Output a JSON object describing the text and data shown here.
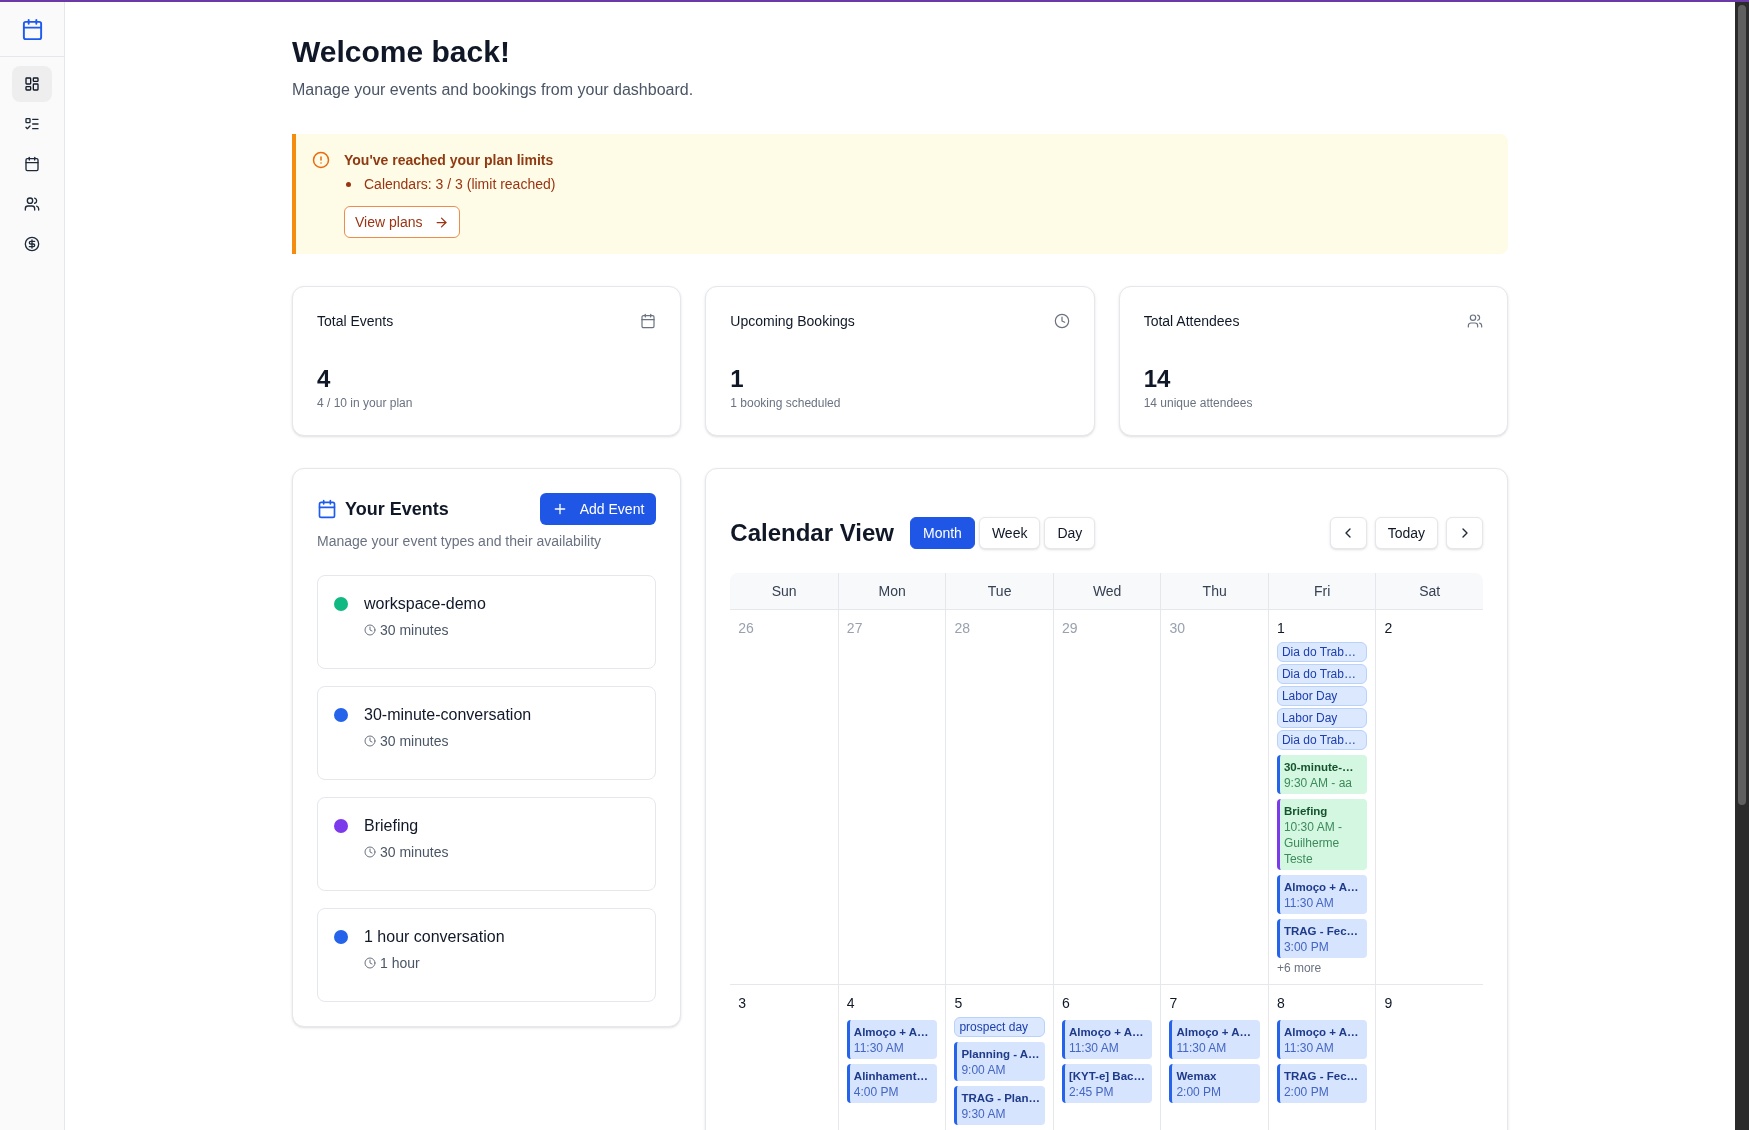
{
  "sidebar": {
    "nav_items": [
      {
        "selected": true
      },
      {
        "selected": false
      },
      {
        "selected": false
      },
      {
        "selected": false
      },
      {
        "selected": false
      }
    ]
  },
  "header": {
    "title": "Welcome back!",
    "subtitle": "Manage your events and bookings from your dashboard."
  },
  "alert": {
    "title": "You've reached your plan limits",
    "items": [
      "Calendars: 3 / 3 (limit reached)"
    ],
    "button": "View plans"
  },
  "stats": [
    {
      "title": "Total Events",
      "value": "4",
      "note": "4 / 10 in your plan"
    },
    {
      "title": "Upcoming Bookings",
      "value": "1",
      "note": "1 booking scheduled"
    },
    {
      "title": "Total Attendees",
      "value": "14",
      "note": "14 unique attendees"
    }
  ],
  "events_panel": {
    "title": "Your Events",
    "add_button": "Add Event",
    "subtitle": "Manage your event types and their availability",
    "events": [
      {
        "name": "workspace-demo",
        "duration": "30 minutes",
        "color": "#10b981"
      },
      {
        "name": "30-minute-conversation",
        "duration": "30 minutes",
        "color": "#2563eb"
      },
      {
        "name": "Briefing",
        "duration": "30 minutes",
        "color": "#7c3aed"
      },
      {
        "name": "1 hour conversation",
        "duration": "1 hour",
        "color": "#2563eb"
      }
    ]
  },
  "calendar": {
    "title": "Calendar View",
    "views": [
      {
        "label": "Month",
        "selected": true
      },
      {
        "label": "Week",
        "selected": false
      },
      {
        "label": "Day",
        "selected": false
      }
    ],
    "today_button": "Today",
    "weekdays": [
      "Sun",
      "Mon",
      "Tue",
      "Wed",
      "Thu",
      "Fri",
      "Sat"
    ],
    "weeks": [
      {
        "days": [
          {
            "day": "26",
            "outside_month": true
          },
          {
            "day": "27",
            "outside_month": true
          },
          {
            "day": "28",
            "outside_month": true
          },
          {
            "day": "29",
            "outside_month": true
          },
          {
            "day": "30",
            "outside_month": true
          },
          {
            "day": "1",
            "outside_month": false,
            "events": [
              {
                "kind": "all_day",
                "title": "Dia do Trab…"
              },
              {
                "kind": "all_day",
                "title": "Dia do Trab…"
              },
              {
                "kind": "all_day",
                "title": "Labor Day"
              },
              {
                "kind": "all_day",
                "title": "Labor Day"
              },
              {
                "kind": "all_day",
                "title": "Dia do Trab…"
              },
              {
                "kind": "booking",
                "title": "30-minute-…",
                "time": "9:30 AM - aa",
                "color": "#2563eb"
              },
              {
                "kind": "booking",
                "title": "Briefing",
                "time": "10:30 AM - Guilherme Teste",
                "color": "#7c3aed"
              },
              {
                "kind": "timed",
                "title": "Almoço + A…",
                "time": "11:30 AM",
                "color": "#2563eb"
              },
              {
                "kind": "timed",
                "title": "TRAG - Fec…",
                "time": "3:00 PM",
                "color": "#2563eb"
              }
            ],
            "more": "+6 more"
          },
          {
            "day": "2",
            "outside_month": false
          }
        ]
      },
      {
        "days": [
          {
            "day": "3",
            "outside_month": false
          },
          {
            "day": "4",
            "outside_month": false,
            "events": [
              {
                "kind": "timed",
                "title": "Almoço + A…",
                "time": "11:30 AM",
                "color": "#2563eb"
              },
              {
                "kind": "timed",
                "title": "Alinhament…",
                "time": "4:00 PM",
                "color": "#2563eb"
              }
            ]
          },
          {
            "day": "5",
            "outside_month": false,
            "events": [
              {
                "kind": "all_day",
                "title": "prospect day"
              },
              {
                "kind": "timed",
                "title": "Planning - A…",
                "time": "9:00 AM",
                "color": "#2563eb"
              },
              {
                "kind": "timed",
                "title": "TRAG - Plan…",
                "time": "9:30 AM",
                "color": "#2563eb"
              }
            ]
          },
          {
            "day": "6",
            "outside_month": false,
            "events": [
              {
                "kind": "timed",
                "title": "Almoço + A…",
                "time": "11:30 AM",
                "color": "#2563eb"
              },
              {
                "kind": "timed",
                "title": "[KYT-e] Bac…",
                "time": "2:45 PM",
                "color": "#2563eb"
              }
            ]
          },
          {
            "day": "7",
            "outside_month": false,
            "events": [
              {
                "kind": "timed",
                "title": "Almoço + A…",
                "time": "11:30 AM",
                "color": "#2563eb"
              },
              {
                "kind": "timed",
                "title": "Wemax",
                "time": "2:00 PM",
                "color": "#2563eb"
              }
            ]
          },
          {
            "day": "8",
            "outside_month": false,
            "events": [
              {
                "kind": "timed",
                "title": "Almoço + A…",
                "time": "11:30 AM",
                "color": "#2563eb"
              },
              {
                "kind": "timed",
                "title": "TRAG - Fec…",
                "time": "2:00 PM",
                "color": "#2563eb"
              }
            ]
          },
          {
            "day": "9",
            "outside_month": false
          }
        ]
      }
    ]
  }
}
